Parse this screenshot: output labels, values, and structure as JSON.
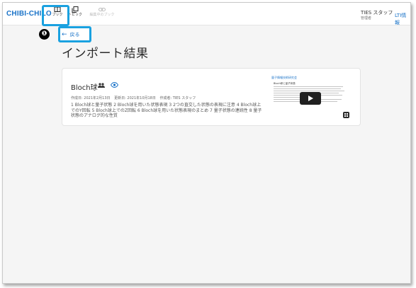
{
  "header": {
    "logo": "CHIBI-CHILO",
    "nav": [
      {
        "label": "ブック",
        "icon": "book-icon"
      },
      {
        "label": "トピック",
        "icon": "topic-icon"
      },
      {
        "label": "編集中のブック",
        "icon": "link-icon"
      }
    ],
    "user": {
      "name": "TIES スタッフ",
      "role": "管理者"
    },
    "lti_label": "LTI情報"
  },
  "step_marker": "❶",
  "back_button": {
    "label": "戻る",
    "icon": "arrow-left-icon"
  },
  "page_title": "インポート結果",
  "book": {
    "title": "Bloch球",
    "shared_icon": "people-icon",
    "visibility_icon": "eye-icon",
    "created": "作成日: 2021年2月13日",
    "updated": "更新日: 2021年10月18日",
    "author": "作成者: TIES スタッフ",
    "description": "1 Bloch球と量子状態 2 Bloch球を用いた状態表現 3 2つの直交した状態の表現に注意 4 Bloch球上でのY回転 5 Bloch球上でのZ回転 6 Bloch球を用いた状態表現のまとめ 7 量子状態の連続性 8 量子状態のアナログ的な性質",
    "thumbnail": {
      "org": "量子情報技術研究会",
      "heading": "Bloch球と量子状態",
      "play_icon": "play-icon"
    },
    "apps_icon": "grid-icon"
  },
  "colors": {
    "accent": "#1a73c8",
    "highlight": "#1aa1e0"
  }
}
